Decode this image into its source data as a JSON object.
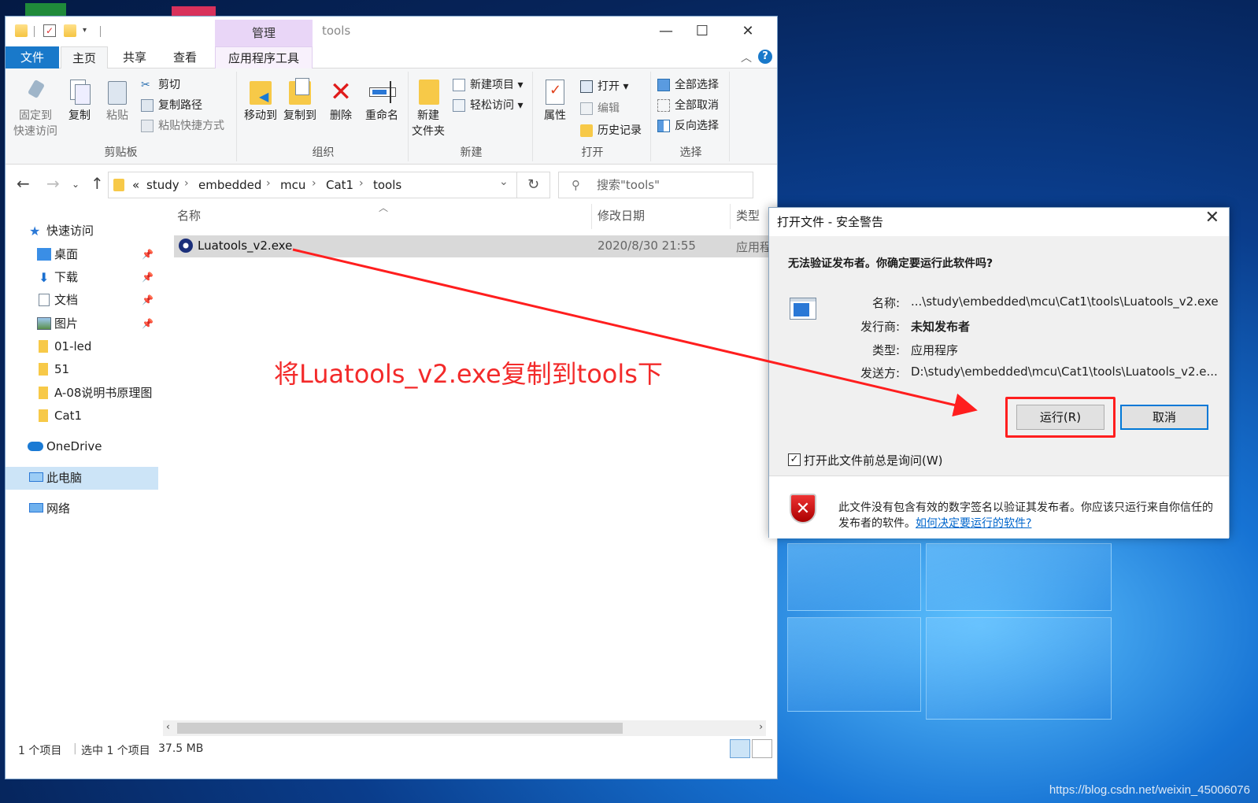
{
  "colors": {
    "accent": "#1979ca",
    "annotation": "#f32a2a",
    "selected_row": "#d9d9d9",
    "nav_selected": "#cce4f7",
    "manage_tab": "#e9d6f7"
  },
  "explorer": {
    "context_tab": "管理",
    "title": "tools",
    "tabs": {
      "file": "文件",
      "home": "主页",
      "share": "共享",
      "view": "查看",
      "app_tools": "应用程序工具"
    },
    "ribbon": {
      "clipboard": {
        "pin": "固定到\n快速访问",
        "copy": "复制",
        "paste": "粘贴",
        "cut": "剪切",
        "copy_path": "复制路径",
        "paste_shortcut": "粘贴快捷方式",
        "label": "剪贴板"
      },
      "organize": {
        "move_to": "移动到",
        "copy_to": "复制到",
        "delete": "删除",
        "rename": "重命名",
        "label": "组织"
      },
      "new": {
        "new_folder": "新建\n文件夹",
        "new_item": "新建项目",
        "easy_access": "轻松访问",
        "label": "新建"
      },
      "open": {
        "properties": "属性",
        "open": "打开",
        "edit": "编辑",
        "history": "历史记录",
        "label": "打开"
      },
      "select": {
        "select_all": "全部选择",
        "select_none": "全部取消",
        "invert": "反向选择",
        "label": "选择"
      }
    },
    "address": {
      "prefix": "«",
      "crumbs": [
        "study",
        "embedded",
        "mcu",
        "Cat1",
        "tools"
      ],
      "search_placeholder": "搜索\"tools\""
    },
    "nav": {
      "quick_access": "快速访问",
      "items": [
        "桌面",
        "下载",
        "文档",
        "图片",
        "01-led",
        "51",
        "A-08说明书原理图",
        "Cat1"
      ],
      "onedrive": "OneDrive",
      "this_pc": "此电脑",
      "network": "网络"
    },
    "columns": {
      "name": "名称",
      "modified": "修改日期",
      "type": "类型"
    },
    "files": [
      {
        "name": "Luatools_v2.exe",
        "modified": "2020/8/30 21:55",
        "type": "应用程"
      }
    ],
    "status": {
      "count": "1 个项目",
      "selected": "选中 1 个项目",
      "size": "37.5 MB"
    }
  },
  "annotation": {
    "text": "将Luatools_v2.exe复制到tools下"
  },
  "dialog": {
    "title": "打开文件 - 安全警告",
    "question": "无法验证发布者。你确定要运行此软件吗?",
    "fields": [
      {
        "label": "名称:",
        "value": "...\\study\\embedded\\mcu\\Cat1\\tools\\Luatools_v2.exe"
      },
      {
        "label": "发行商:",
        "value": "未知发布者"
      },
      {
        "label": "类型:",
        "value": "应用程序"
      },
      {
        "label": "发送方:",
        "value": "D:\\study\\embedded\\mcu\\Cat1\\tools\\Luatools_v2.e..."
      }
    ],
    "run_button": "运行(R)",
    "cancel_button": "取消",
    "checkbox_label": "打开此文件前总是询问(W)",
    "checkbox_checked": true,
    "warning": "此文件没有包含有效的数字签名以验证其发布者。你应该只运行来自你信任的发布者的软件。",
    "warning_link": "如何决定要运行的软件?"
  },
  "watermark": "https://blog.csdn.net/weixin_45006076"
}
